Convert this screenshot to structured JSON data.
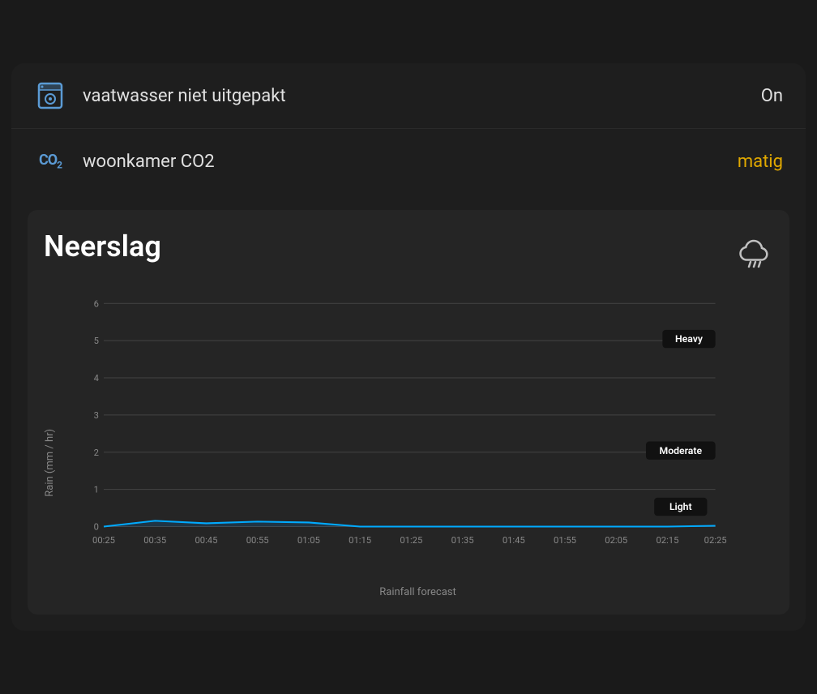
{
  "items": [
    {
      "id": "dishwasher",
      "icon": "dishwasher",
      "label": "vaatwasser niet uitgepakt",
      "value": "On",
      "value_color": "normal"
    },
    {
      "id": "co2",
      "icon": "co2",
      "label": "woonkamer CO2",
      "value": "matig",
      "value_color": "warning"
    }
  ],
  "chart": {
    "title": "Neerslag",
    "icon": "cloud-rain",
    "y_axis_label": "Rain (mm / hr)",
    "x_axis_label": "Rainfall forecast",
    "y_ticks": [
      "0",
      "1",
      "2",
      "3",
      "4",
      "5",
      "6"
    ],
    "x_ticks": [
      "00:25",
      "00:35",
      "00:45",
      "00:55",
      "01:05",
      "01:15",
      "01:25",
      "01:35",
      "01:45",
      "01:55",
      "02:05",
      "02:15",
      "02:25"
    ],
    "thresholds": [
      {
        "label": "Heavy",
        "value": 5
      },
      {
        "label": "Moderate",
        "value": 2
      },
      {
        "label": "Light",
        "value": 0.5
      }
    ]
  }
}
